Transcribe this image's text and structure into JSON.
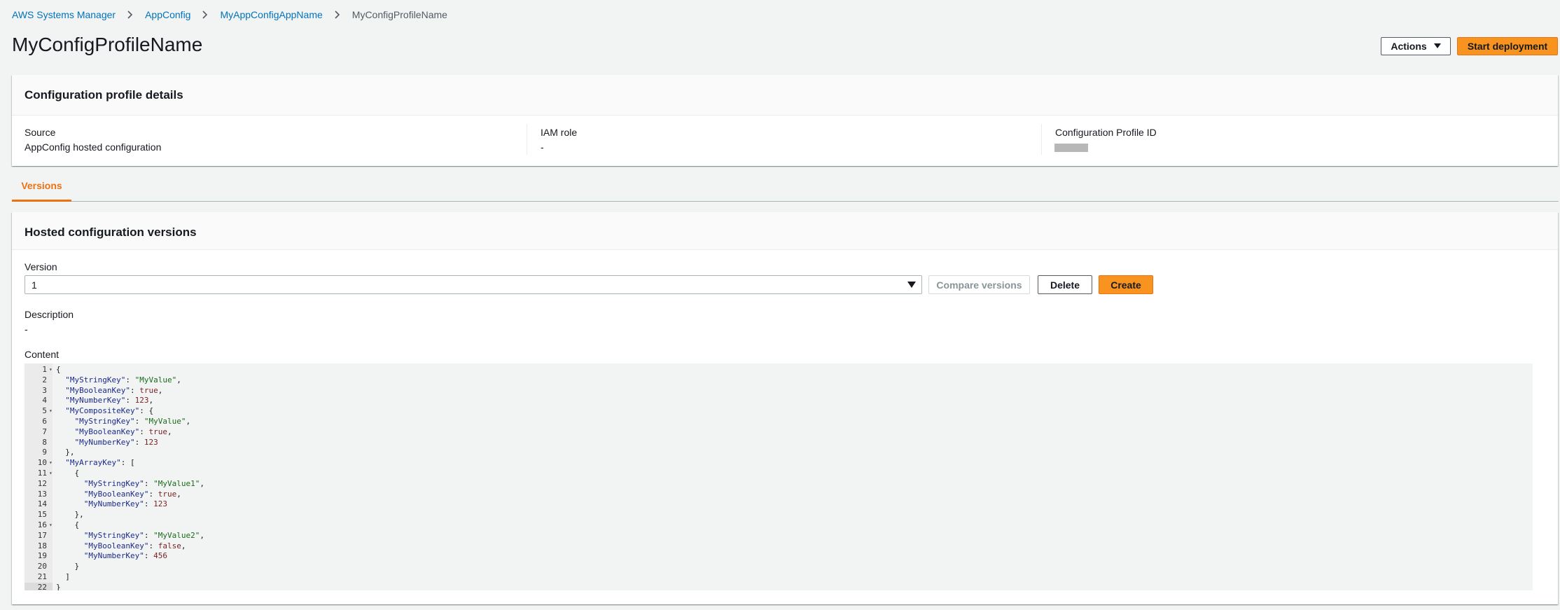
{
  "breadcrumb": {
    "items": [
      "AWS Systems Manager",
      "AppConfig",
      "MyAppConfigAppName"
    ],
    "current": "MyConfigProfileName"
  },
  "header": {
    "title": "MyConfigProfileName",
    "actions_label": "Actions",
    "start_deployment_label": "Start deployment"
  },
  "details": {
    "title": "Configuration profile details",
    "source_label": "Source",
    "source_value": "AppConfig hosted configuration",
    "iam_label": "IAM role",
    "iam_value": "-",
    "profile_id_label": "Configuration Profile ID",
    "profile_id_value": "[redacted]"
  },
  "tabs": [
    {
      "label": "Versions",
      "active": true
    }
  ],
  "versions": {
    "title": "Hosted configuration versions",
    "version_label": "Version",
    "version_value": "1",
    "compare_label": "Compare versions",
    "delete_label": "Delete",
    "create_label": "Create",
    "description_label": "Description",
    "description_value": "-",
    "content_label": "Content"
  },
  "content_lines": [
    "{",
    "  \"MyStringKey\": \"MyValue\",",
    "  \"MyBooleanKey\": true,",
    "  \"MyNumberKey\": 123,",
    "  \"MyCompositeKey\": {",
    "    \"MyStringKey\": \"MyValue\",",
    "    \"MyBooleanKey\": true,",
    "    \"MyNumberKey\": 123",
    "  },",
    "  \"MyArrayKey\": [",
    "    {",
    "      \"MyStringKey\": \"MyValue1\",",
    "      \"MyBooleanKey\": true,",
    "      \"MyNumberKey\": 123",
    "    },",
    "    {",
    "      \"MyStringKey\": \"MyValue2\",",
    "      \"MyBooleanKey\": false,",
    "      \"MyNumberKey\": 456",
    "    }",
    "  ]",
    "}"
  ],
  "fold_lines": [
    1,
    5,
    10,
    11,
    16
  ],
  "colors": {
    "accent": "#ec7211",
    "link": "#0073bb",
    "primary_button": "#f7931e"
  }
}
